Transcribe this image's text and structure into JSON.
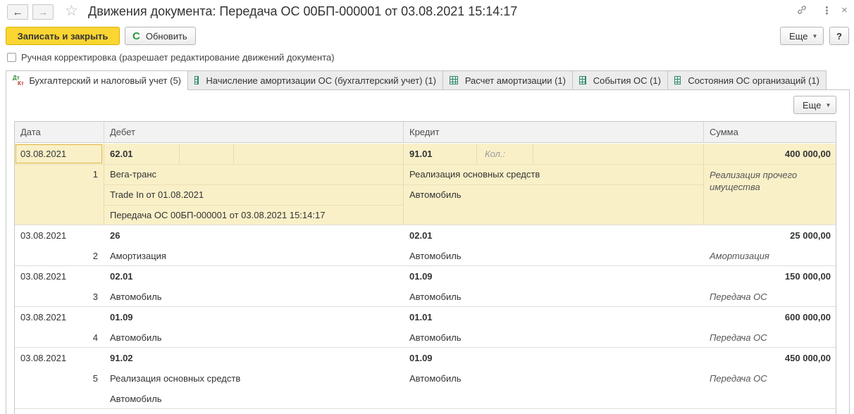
{
  "window": {
    "title": "Движения документа: Передача ОС 00БП-000001 от 03.08.2021 15:14:17",
    "back_icon": "←",
    "forward_icon": "→",
    "star_icon": "☆",
    "link_icon": "🔗",
    "more_icon": "⋮",
    "close_icon": "×"
  },
  "toolbar": {
    "save_close_label": "Записать и закрыть",
    "refresh_icon": "C",
    "refresh_label": "Обновить",
    "more_label": "Еще",
    "help_label": "?"
  },
  "manual_correction": {
    "label": "Ручная корректировка (разрешает редактирование движений документа)",
    "checked": false
  },
  "tabs": [
    {
      "label": "Бухгалтерский и налоговый учет (5)",
      "icon": "dtkt-icon",
      "active": true
    },
    {
      "label": "Начисление амортизации ОС (бухгалтерский учет) (1)",
      "icon": "grid-icon",
      "active": false
    },
    {
      "label": "Расчет амортизации (1)",
      "icon": "grid-icon",
      "active": false
    },
    {
      "label": "События ОС (1)",
      "icon": "grid-icon",
      "active": false
    },
    {
      "label": "Состояния ОС организаций (1)",
      "icon": "grid-icon",
      "active": false
    }
  ],
  "tab_icon_text": {
    "dt": "Дт",
    "kt": "Кт"
  },
  "panel": {
    "more_label": "Еще"
  },
  "table": {
    "columns": {
      "date": "Дата",
      "debit": "Дебет",
      "credit": "Кредит",
      "amount": "Сумма"
    },
    "rows": [
      {
        "date": "03.08.2021",
        "num": "1",
        "debit_account": "62.01",
        "credit_account": "91.01",
        "credit_qty_label": "Кол.:",
        "amount": "400 000,00",
        "debit_sub": [
          "Вега-транс",
          "Trade In от 01.08.2021",
          "Передача ОС 00БП-000001 от 03.08.2021 15:14:17"
        ],
        "credit_sub": [
          "Реализация основных средств",
          "Автомобиль"
        ],
        "content": "Реализация прочего имущества",
        "selected": true
      },
      {
        "date": "03.08.2021",
        "num": "2",
        "debit_account": "26",
        "credit_account": "02.01",
        "amount": "25 000,00",
        "debit_sub": [
          "Амортизация"
        ],
        "credit_sub": [
          "Автомобиль"
        ],
        "content": "Амортизация"
      },
      {
        "date": "03.08.2021",
        "num": "3",
        "debit_account": "02.01",
        "credit_account": "01.09",
        "amount": "150 000,00",
        "debit_sub": [
          "Автомобиль"
        ],
        "credit_sub": [
          "Автомобиль"
        ],
        "content": "Передача ОС"
      },
      {
        "date": "03.08.2021",
        "num": "4",
        "debit_account": "01.09",
        "credit_account": "01.01",
        "amount": "600 000,00",
        "debit_sub": [
          "Автомобиль"
        ],
        "credit_sub": [
          "Автомобиль"
        ],
        "content": "Передача ОС"
      },
      {
        "date": "03.08.2021",
        "num": "5",
        "debit_account": "91.02",
        "credit_account": "01.09",
        "amount": "450 000,00",
        "debit_sub": [
          "Реализация основных средств",
          "Автомобиль"
        ],
        "credit_sub": [
          "Автомобиль"
        ],
        "content": "Передача ОС"
      }
    ]
  }
}
